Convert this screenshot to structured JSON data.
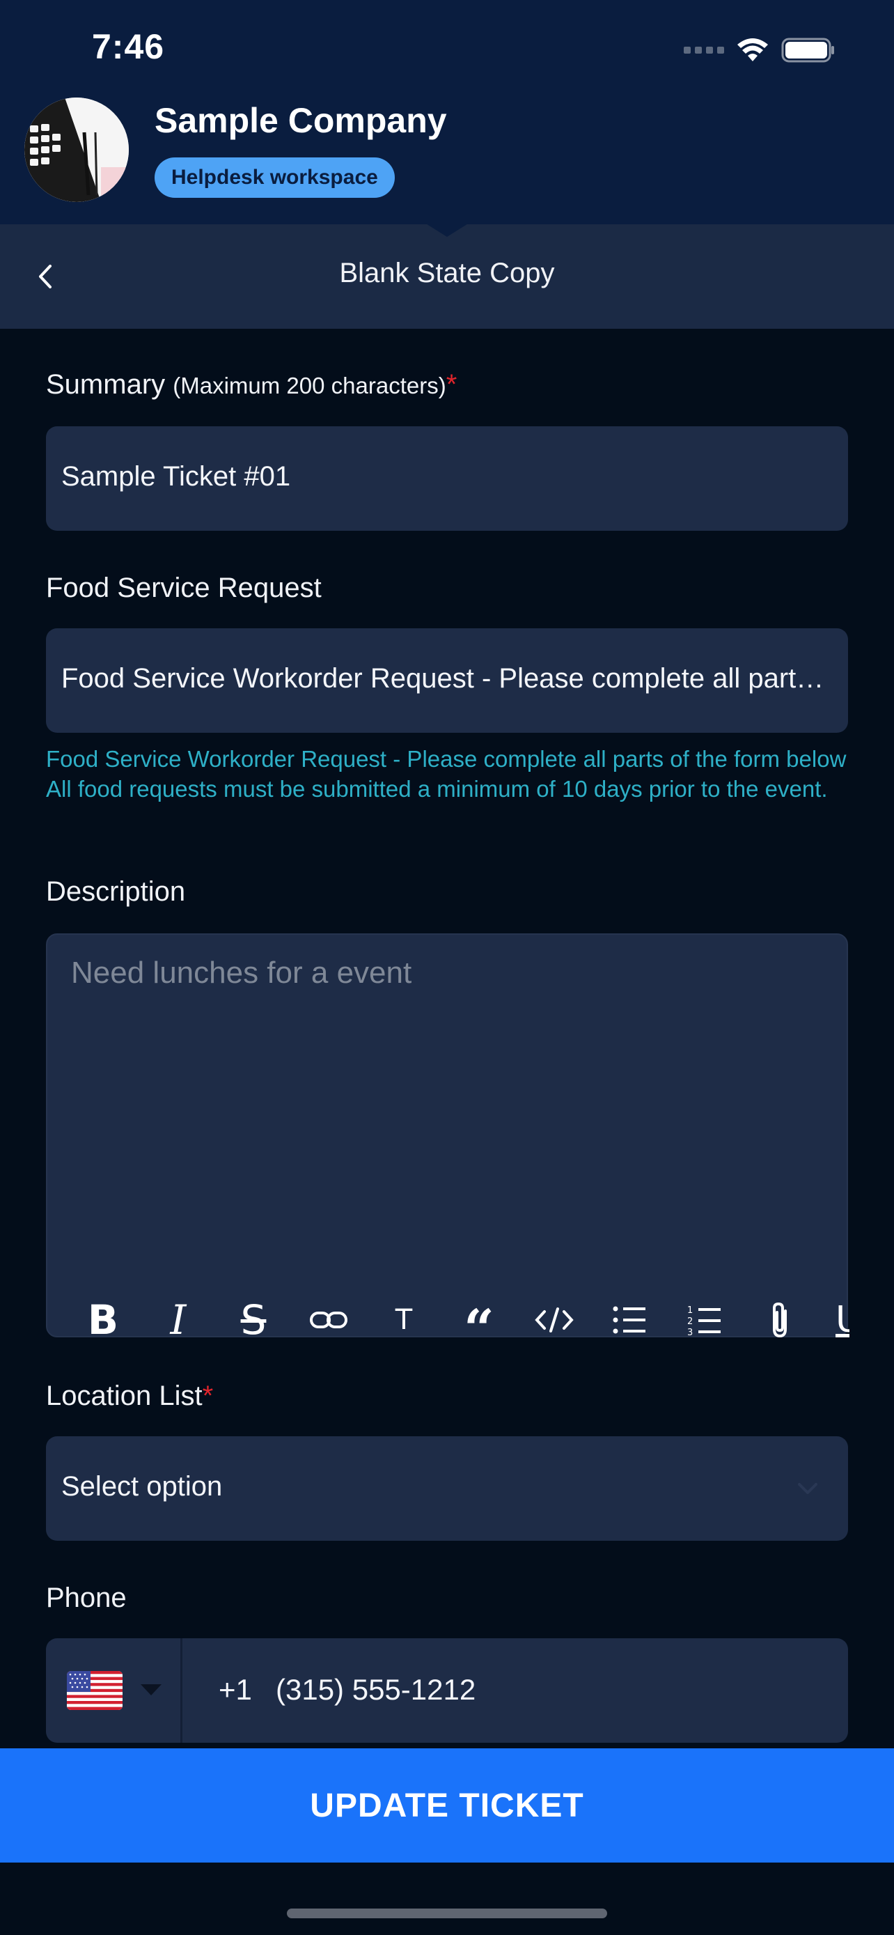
{
  "status_bar": {
    "time": "7:46"
  },
  "header": {
    "company_name": "Sample Company",
    "workspace_badge": "Helpdesk workspace"
  },
  "nav": {
    "title": "Blank State Copy"
  },
  "form": {
    "summary": {
      "label": "Summary",
      "hint": "(Maximum 200 characters)",
      "required_mark": "*",
      "value": "Sample Ticket #01"
    },
    "food_service": {
      "label": "Food Service Request",
      "value": "Food Service Workorder Request - Please complete all part…",
      "helper": "Food Service Workorder Request - Please complete all parts of the form below All food requests must be submitted a minimum of 10 days prior to the event."
    },
    "description": {
      "label": "Description",
      "placeholder": "Need lunches for a event",
      "toolbar": [
        "bold-icon",
        "italic-icon",
        "strikethrough-icon",
        "link-icon",
        "text-format-icon",
        "quote-icon",
        "code-icon",
        "bulleted-list-icon",
        "numbered-list-icon",
        "attachment-icon",
        "underline-icon"
      ]
    },
    "location": {
      "label": "Location List",
      "required_mark": "*",
      "value": "Select option"
    },
    "phone": {
      "label": "Phone",
      "country_flag": "us-flag",
      "country_code": "+1",
      "number": "(315) 555-1212"
    }
  },
  "actions": {
    "update_label": "UPDATE TICKET"
  },
  "colors": {
    "header_bg": "#0a1d3f",
    "nav_bg": "#1b2a45",
    "page_bg": "#030d1a",
    "field_bg": "#1e2c47",
    "badge": "#4ea3f5",
    "helper_text": "#2eb0c7",
    "required": "#e0252c",
    "primary_button": "#1a73fa"
  }
}
